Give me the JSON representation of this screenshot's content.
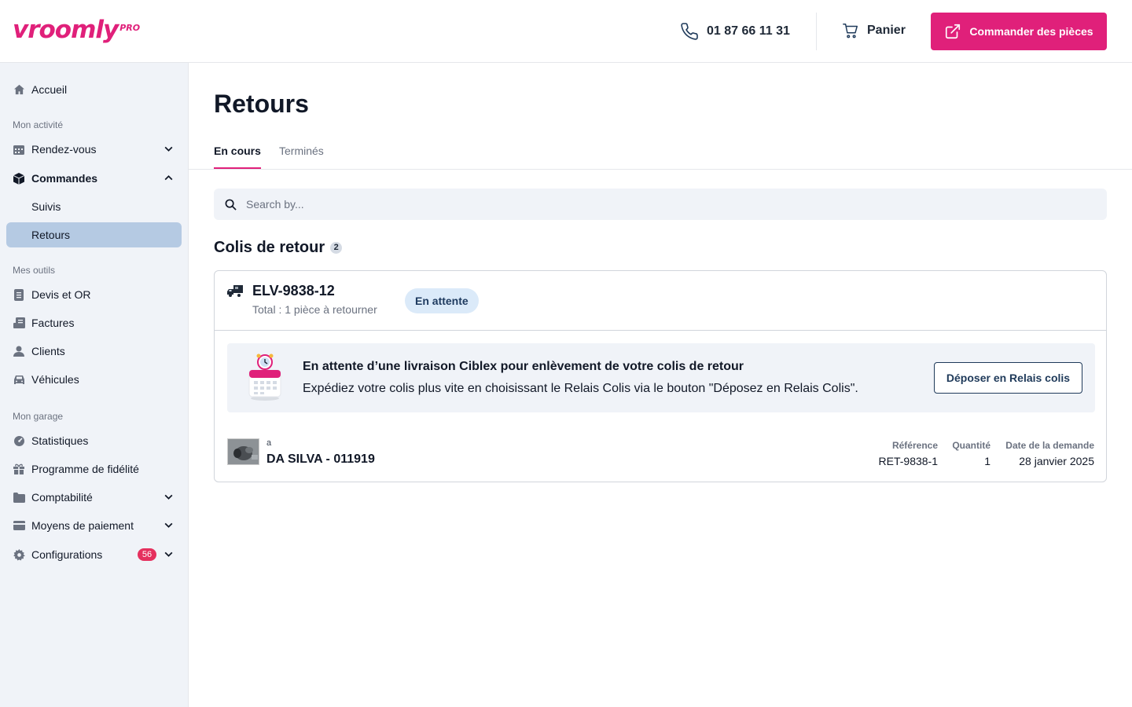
{
  "header": {
    "logo_text": "vroomly",
    "logo_suffix": "PRO",
    "phone": "01 87 66 11 31",
    "cart_label": "Panier",
    "order_label": "Commander des pièces"
  },
  "sidebar": {
    "home": "Accueil",
    "section_activity": "Mon activité",
    "rdv": "Rendez-vous",
    "orders": "Commandes",
    "orders_tracking": "Suivis",
    "orders_returns": "Retours",
    "section_tools": "Mes outils",
    "quotes": "Devis et OR",
    "invoices": "Factures",
    "clients": "Clients",
    "vehicles": "Véhicules",
    "section_garage": "Mon garage",
    "stats": "Statistiques",
    "loyalty": "Programme de fidélité",
    "accounting": "Comptabilité",
    "payment": "Moyens de paiement",
    "config": "Configurations",
    "config_badge": "56"
  },
  "main": {
    "title": "Retours",
    "tabs": [
      {
        "label": "En cours",
        "active": true
      },
      {
        "label": "Terminés",
        "active": false
      }
    ],
    "search_placeholder": "Search by...",
    "section_title": "Colis de retour",
    "section_count": "2"
  },
  "parcel": {
    "id": "ELV-9838-12",
    "total": "Total : 1 pièce à retourner",
    "status": "En attente",
    "status_color": "#dbeaf9",
    "info_title": "En attente d’une livraison Ciblex pour enlèvement de votre colis de retour",
    "info_text": "Expédiez votre colis plus vite en choisissant le Relais Colis via le bouton \"Déposez en Relais Colis\".",
    "relay_button": "Déposer en Relais colis",
    "item": {
      "label_small": "a",
      "name": "DA SILVA - 011919",
      "ref_header": "Référence",
      "ref_value": "RET-9838-1",
      "qty_header": "Quantité",
      "qty_value": "1",
      "date_header": "Date de la demande",
      "date_value": "28 janvier 2025"
    }
  },
  "colors": {
    "brand": "#e0207a",
    "sidebar_bg": "#f0f3f8",
    "active_item": "#b5cae3"
  }
}
